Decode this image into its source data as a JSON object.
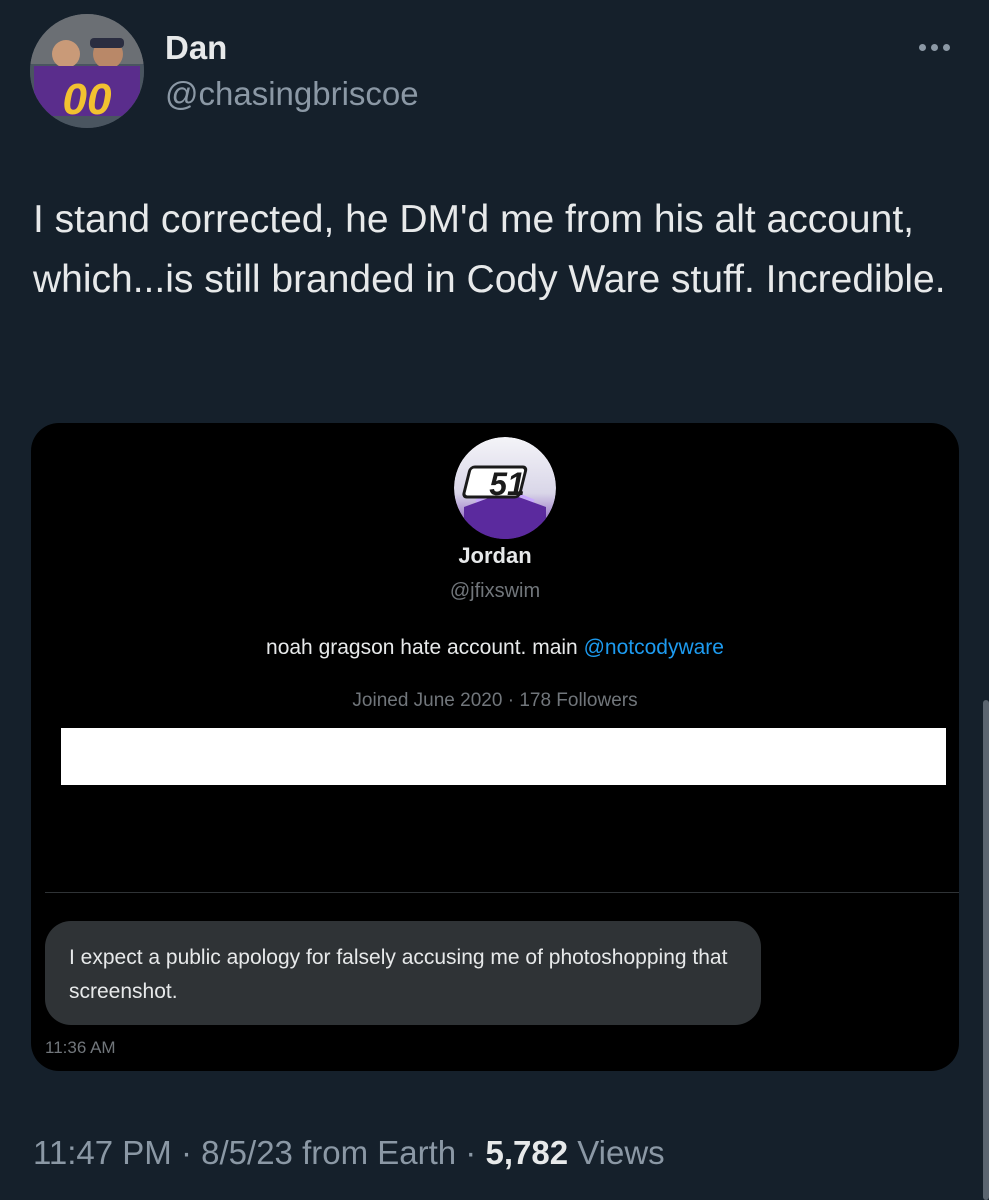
{
  "author": {
    "display_name": "Dan",
    "handle": "@chasingbriscoe",
    "avatar_icon": "profile-photo-two-men-holding-00-banner"
  },
  "tweet": {
    "text": "I stand corrected, he DM'd me from his alt account, which...is still branded in Cody Ware stuff. Incredible.",
    "time": "11:47 PM",
    "date": "8/5/23",
    "source": "from Earth",
    "views_count": "5,782",
    "views_label": "Views",
    "separator": "·"
  },
  "embedded_screenshot": {
    "profile": {
      "avatar_icon": "number-51-logo",
      "avatar_text": "51",
      "name": "Jordan",
      "handle": "@jfixswim",
      "bio_text": "noah gragson hate account. main ",
      "bio_mention": "@notcodyware",
      "joined": "Joined June 2020",
      "separator": "·",
      "followers": "178 Followers"
    },
    "message": {
      "text": "I expect a public apology for falsely accusing me of photoshopping that screenshot.",
      "time": "11:36 AM"
    }
  },
  "colors": {
    "background": "#15202b",
    "text_primary": "#e7e9ea",
    "text_secondary": "#8b98a5",
    "link": "#1d9bf0"
  }
}
